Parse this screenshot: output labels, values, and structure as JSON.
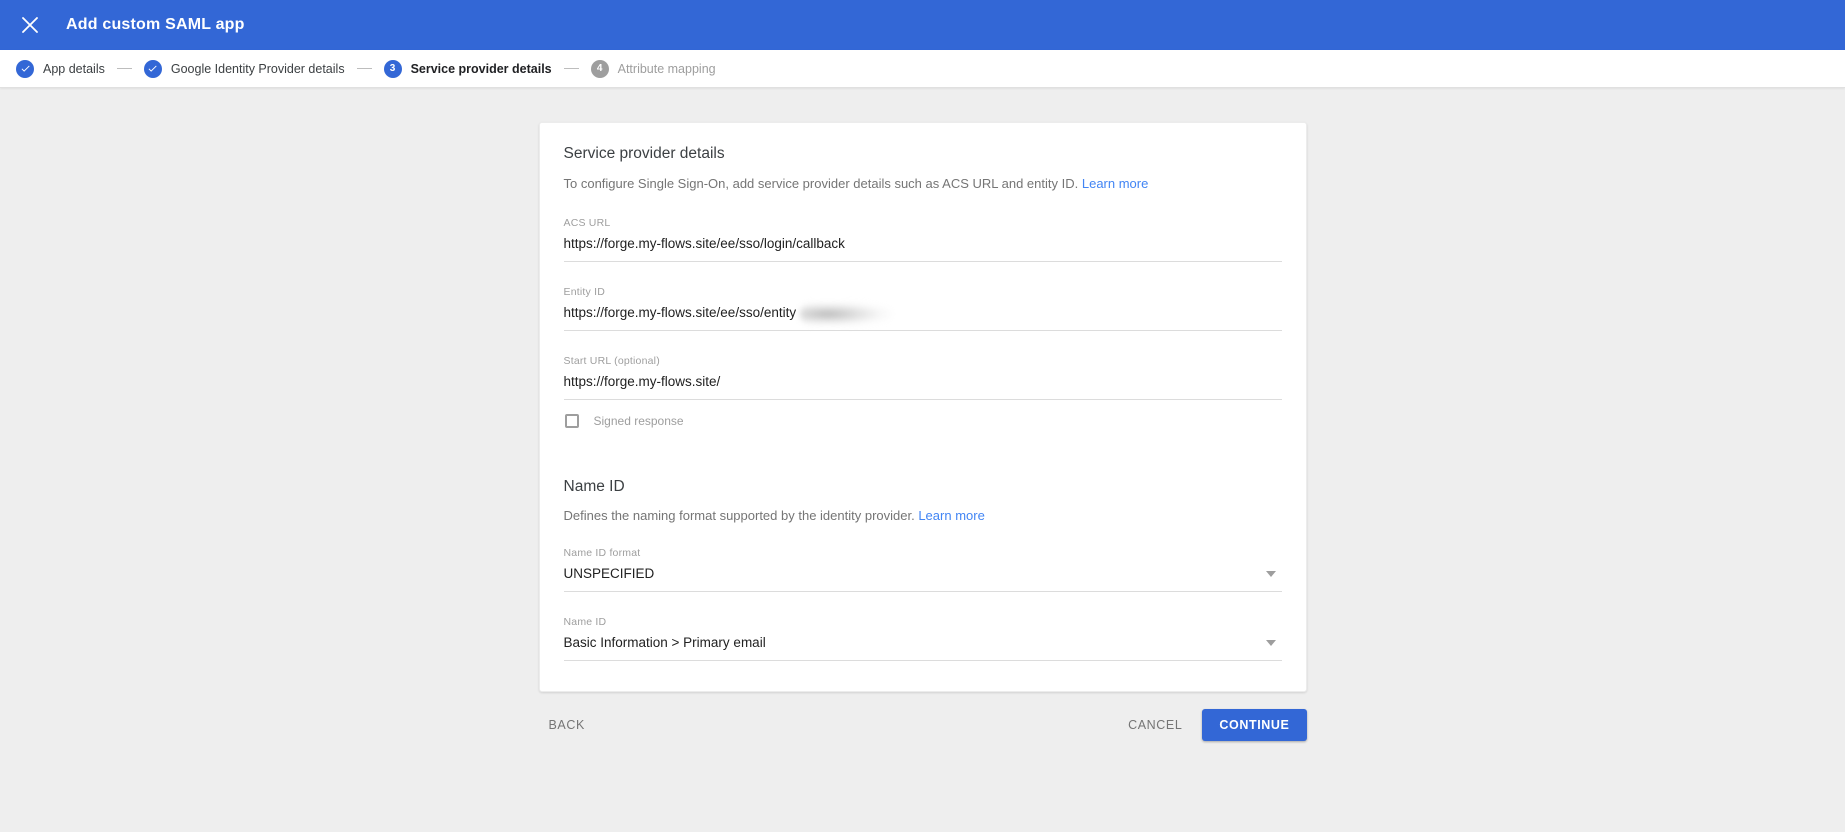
{
  "app_bar": {
    "title": "Add custom SAML app"
  },
  "stepper": {
    "steps": [
      {
        "label": "App details",
        "state": "complete"
      },
      {
        "label": "Google Identity Provider details",
        "state": "complete"
      },
      {
        "label": "Service provider details",
        "state": "active",
        "number": "3"
      },
      {
        "label": "Attribute mapping",
        "state": "upcoming",
        "number": "4"
      }
    ]
  },
  "card": {
    "title": "Service provider details",
    "description": "To configure Single Sign-On, add service provider details such as ACS URL and entity ID.",
    "learn_more": "Learn more",
    "fields": {
      "acs_url": {
        "label": "ACS URL",
        "value": "https://forge.my-flows.site/ee/sso/login/callback"
      },
      "entity_id": {
        "label": "Entity ID",
        "value": "https://forge.my-flows.site/ee/sso/entity"
      },
      "start_url": {
        "label": "Start URL (optional)",
        "value": "https://forge.my-flows.site/"
      }
    },
    "signed_response": {
      "label": "Signed response",
      "checked": false
    },
    "name_id_section": {
      "title": "Name ID",
      "description": "Defines the naming format supported by the identity provider.",
      "learn_more": "Learn more",
      "name_id_format": {
        "label": "Name ID format",
        "value": "UNSPECIFIED"
      },
      "name_id": {
        "label": "Name ID",
        "value": "Basic Information > Primary email"
      }
    }
  },
  "footer": {
    "back": "BACK",
    "cancel": "CANCEL",
    "continue": "CONTINUE"
  },
  "colors": {
    "primary_blue": "#3367d6",
    "page_bg": "#eeeeee",
    "link_blue": "#4285f4"
  }
}
